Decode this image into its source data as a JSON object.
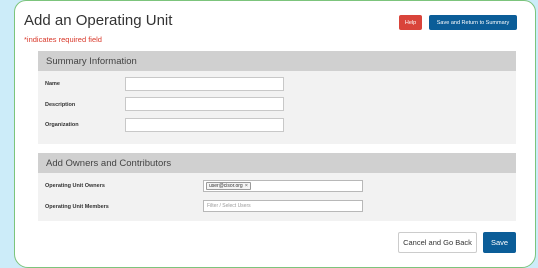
{
  "header": {
    "title": "Add an Operating Unit",
    "required_note": "*indicates required field",
    "help_label": "Help",
    "save_return_label": "Save and Return to Summary"
  },
  "summary_section": {
    "title": "Summary Information",
    "fields": {
      "name_label": "Name",
      "description_label": "Description",
      "organization_label": "Organization"
    }
  },
  "owners_section": {
    "title": "Add Owners and Contributors",
    "owners_label": "Operating Unit Owners",
    "owner_tag": "user@cisor.org",
    "owner_tag_remove": "×",
    "members_label": "Operating Unit Members",
    "members_placeholder": "Filter / Select Users"
  },
  "footer": {
    "cancel_label": "Cancel and Go Back",
    "save_label": "Save"
  },
  "colors": {
    "background": "#ccecf9",
    "card_border": "#7cc47c",
    "help_button": "#d9443b",
    "primary_button": "#0b5d98",
    "required_text": "#d9392b",
    "section_header": "#d0d0d0",
    "section_body": "#f2f2f2"
  }
}
